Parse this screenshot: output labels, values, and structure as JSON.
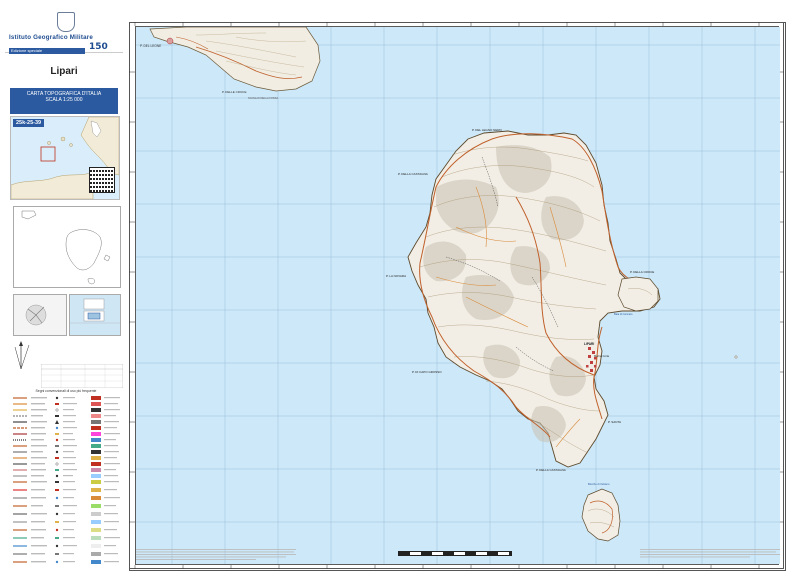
{
  "sidebar": {
    "publisher": "Istituto Geografico Militare",
    "edition": "Edizione speciale",
    "sheet_name": "Lipari",
    "carta_title": "CARTA TOPOGRAFICA D'ITALIA",
    "scale": "SCALA 1:25 000",
    "sheet_code": "25k-25-39",
    "legend_title": "Segni convenzionali di uso più frequente"
  },
  "map": {
    "sea_color": "#cde8f8",
    "land_color": "#f2eee6",
    "road_color": "#c0602a",
    "frame_color": "#555555"
  }
}
